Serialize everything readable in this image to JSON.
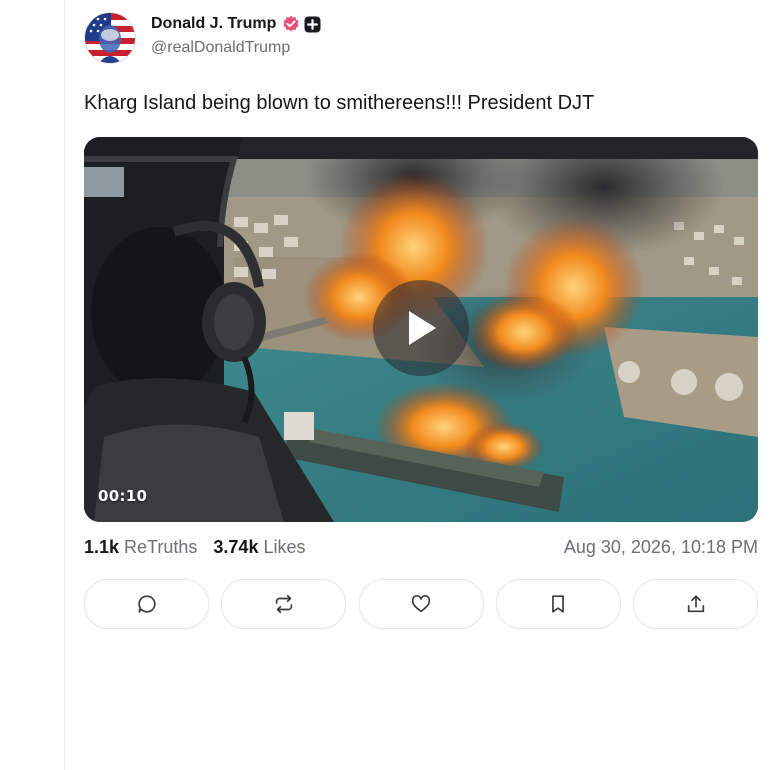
{
  "author": {
    "name": "Donald J. Trump",
    "handle": "@realDonaldTrump",
    "avatar_icon": "avatar-flag-portrait-icon",
    "verified_icon": "verified-badge-icon",
    "plus_icon": "plus-badge-icon"
  },
  "post": {
    "text": "Kharg Island being blown to smithereens!!! President DJT"
  },
  "media": {
    "type": "video",
    "duration": "00:10",
    "play_icon": "play-icon"
  },
  "stats": {
    "retruths_count": "1.1k",
    "retruths_label": "ReTruths",
    "likes_count": "3.74k",
    "likes_label": "Likes",
    "timestamp": "Aug 30, 2026, 10:18 PM"
  },
  "actions": [
    {
      "name": "reply",
      "icon": "reply-icon"
    },
    {
      "name": "retruth",
      "icon": "retruth-icon"
    },
    {
      "name": "like",
      "icon": "heart-icon"
    },
    {
      "name": "bookmark",
      "icon": "bookmark-icon"
    },
    {
      "name": "share",
      "icon": "share-icon"
    }
  ],
  "colors": {
    "verified": "#e8507a",
    "text_primary": "#17171a",
    "text_secondary": "#6e6e73"
  }
}
